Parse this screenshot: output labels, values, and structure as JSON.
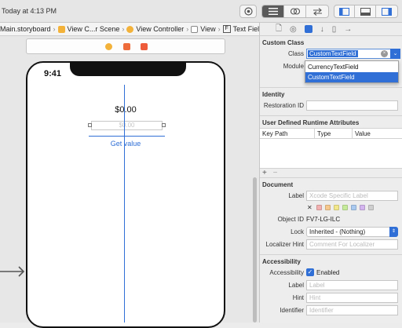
{
  "toolbar": {
    "status": "Today at 4:13 PM"
  },
  "jumpbar": {
    "items": [
      "Main.storyboard",
      "View C...r Scene",
      "View Controller",
      "View",
      "Text Field"
    ]
  },
  "phone": {
    "time": "9:41",
    "price_label": "$0.00",
    "textfield_placeholder": "$0.00",
    "button_label": "Get value"
  },
  "inspector": {
    "custom_class": {
      "title": "Custom Class",
      "class_label": "Class",
      "class_value": "CustomTextField",
      "module_label": "Module",
      "options": [
        "CurrencyTextField",
        "CustomTextField"
      ],
      "selected_option": "CustomTextField"
    },
    "identity": {
      "title": "Identity",
      "restoration_label": "Restoration ID"
    },
    "runtime": {
      "title": "User Defined Runtime Attributes",
      "columns": [
        "Key Path",
        "Type",
        "Value"
      ],
      "add": "+",
      "remove": "−"
    },
    "document": {
      "title": "Document",
      "label_label": "Label",
      "label_placeholder": "Xcode Specific Label",
      "clear_symbol": "✕",
      "swatch_colors": [
        "#f2b0b0",
        "#f6c88e",
        "#f2e78a",
        "#c6eb9a",
        "#a9c9f0",
        "#d3b4ee",
        "#cfcfcf"
      ],
      "object_id_label": "Object ID",
      "object_id": "FV7-LG-ILC",
      "lock_label": "Lock",
      "lock_value": "Inherited - (Nothing)",
      "hint_label": "Localizer Hint",
      "hint_placeholder": "Comment For Localizer"
    },
    "accessibility": {
      "title": "Accessibility",
      "enabled_label": "Accessibility",
      "enabled_text": "Enabled",
      "label_label": "Label",
      "label_placeholder": "Label",
      "hint_label": "Hint",
      "hint_placeholder": "Hint",
      "identifier_label": "Identifier",
      "identifier_placeholder": "Identifier"
    }
  }
}
